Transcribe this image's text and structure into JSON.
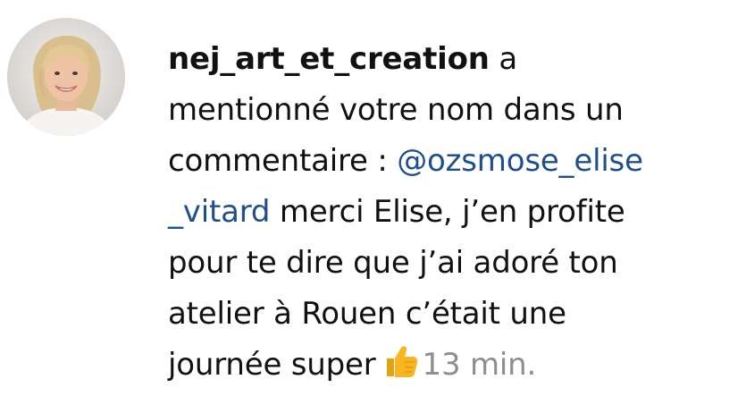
{
  "notification": {
    "avatar_icon": "user-avatar-photo",
    "username": "nej_art_et_creation",
    "line1_rest": " a",
    "line2": "mentionné votre nom dans un",
    "line3_text": "commentaire : ",
    "mention_part1": "@ozsmose_elise",
    "mention_part2": "_vitard",
    "line4_rest": " merci Elise, j’en profite",
    "line5": "pour te dire que j’ai adoré ton",
    "line6": "atelier à Rouen c’était une",
    "line7_text": "journée super",
    "emoji_icon": "thumbs-up-icon",
    "time": "13 min."
  },
  "colors": {
    "text": "#111111",
    "mention": "#1f4f8f",
    "time": "#8e8e8e",
    "emoji": "#f7b520"
  }
}
